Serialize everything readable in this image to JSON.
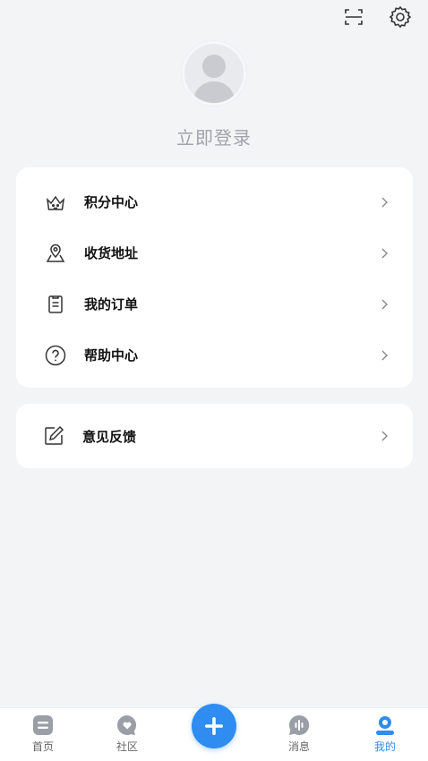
{
  "header": {
    "scan_icon": "scan-icon",
    "settings_icon": "gear-icon"
  },
  "profile": {
    "login_label": "立即登录"
  },
  "menu": {
    "items": [
      {
        "label": "积分中心",
        "icon": "crown-icon"
      },
      {
        "label": "收货地址",
        "icon": "location-icon"
      },
      {
        "label": "我的订单",
        "icon": "order-icon"
      },
      {
        "label": "帮助中心",
        "icon": "help-icon"
      }
    ],
    "feedback": {
      "label": "意见反馈",
      "icon": "edit-icon"
    },
    "chevron": ">"
  },
  "tabbar": {
    "items": [
      {
        "label": "首页",
        "icon": "home-icon"
      },
      {
        "label": "社区",
        "icon": "community-icon"
      },
      {
        "label": "",
        "icon": "plus-icon"
      },
      {
        "label": "消息",
        "icon": "message-icon"
      },
      {
        "label": "我的",
        "icon": "profile-icon",
        "active": true
      }
    ]
  },
  "colors": {
    "accent": "#2f8cf0",
    "background": "#f3f4f6",
    "card": "#ffffff",
    "muted_text": "#9fa3aa"
  }
}
